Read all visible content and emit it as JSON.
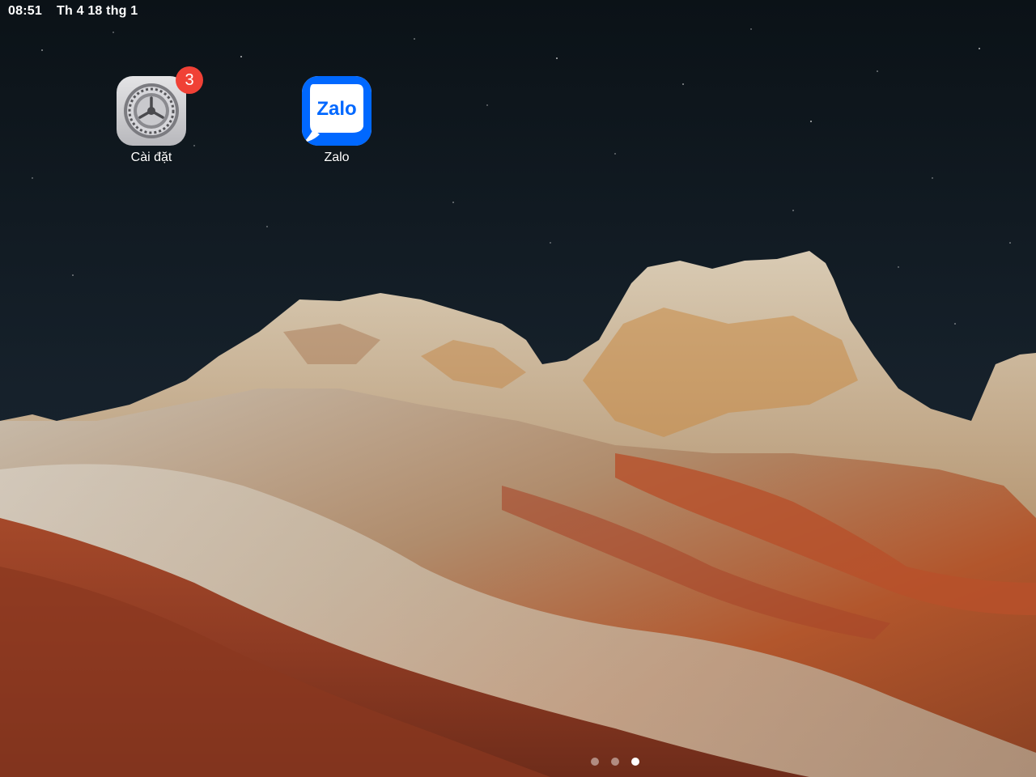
{
  "status_bar": {
    "time": "08:51",
    "date": "Th 4 18 thg 1"
  },
  "apps": [
    {
      "label": "Cài đặt",
      "icon": "settings-gear-icon",
      "badge": "3"
    },
    {
      "label": "Zalo",
      "icon": "zalo-icon",
      "logo_text": "Zalo"
    }
  ],
  "page_indicator": {
    "count": 3,
    "current": 3
  },
  "colors": {
    "badge": "#f04136",
    "zalo_blue": "#0068ff",
    "sky": "#0c1318"
  }
}
